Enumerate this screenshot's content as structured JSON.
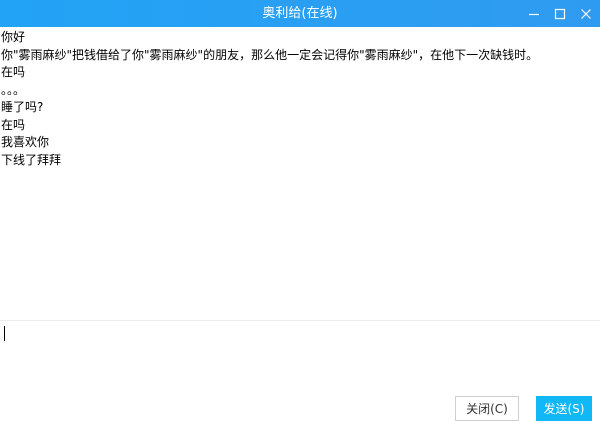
{
  "window": {
    "title": "奥利给(在线)",
    "accent": "#2f9bf0"
  },
  "messages": [
    "你好",
    "你\"雾雨麻纱\"把钱借给了你\"雾雨麻纱\"的朋友，那么他一定会记得你\"雾雨麻纱\"，在他下一次缺钱时。",
    "在吗",
    "。。。",
    "睡了吗?",
    "在吗",
    "我喜欢你",
    "下线了拜拜"
  ],
  "input": {
    "value": ""
  },
  "buttons": {
    "close_label": "关闭(C)",
    "send_label": "发送(S)",
    "send_color": "#12b7f5"
  }
}
